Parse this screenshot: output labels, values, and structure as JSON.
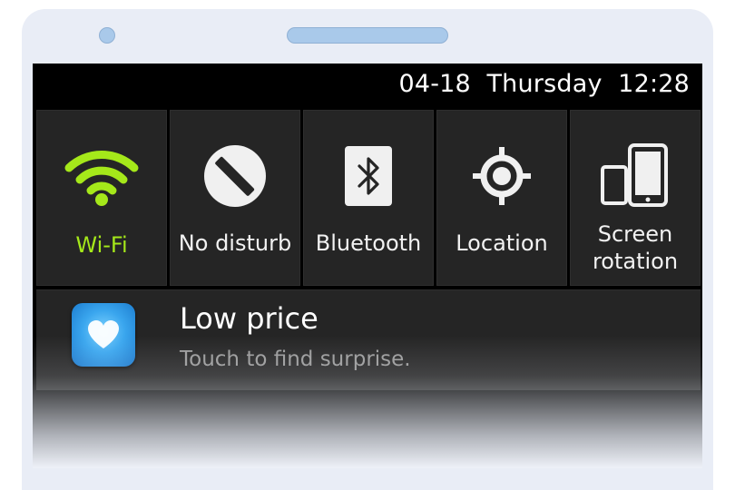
{
  "status_bar": {
    "datetime": "04-18  Thursday  12:28"
  },
  "quick_settings": {
    "tiles": [
      {
        "label": "Wi-Fi",
        "icon": "wifi-icon",
        "active": true
      },
      {
        "label": "No disturb",
        "icon": "no-disturb-icon",
        "active": false
      },
      {
        "label": "Bluetooth",
        "icon": "bluetooth-icon",
        "active": false
      },
      {
        "label": "Location",
        "icon": "location-icon",
        "active": false
      },
      {
        "label": "Screen\nrotation",
        "icon": "screen-rotation-icon",
        "active": false
      }
    ]
  },
  "notification": {
    "title": "Low price",
    "subtitle": "Touch to find surprise.",
    "icon": "heart-app-icon"
  },
  "colors": {
    "active_tile": "#a5e81a",
    "tile_background": "#252525",
    "phone_body": "#e9edf6"
  }
}
